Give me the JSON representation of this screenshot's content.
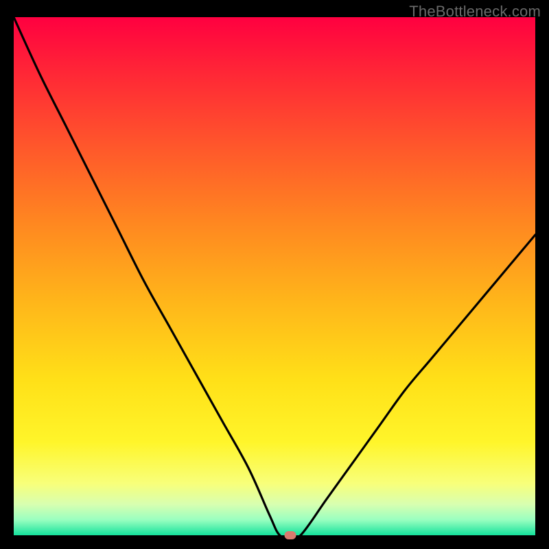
{
  "watermark": "TheBottleneck.com",
  "chart_data": {
    "type": "line",
    "title": "",
    "xlabel": "",
    "ylabel": "",
    "xlim": [
      0,
      100
    ],
    "ylim": [
      0,
      100
    ],
    "x": [
      0,
      5,
      10,
      15,
      20,
      25,
      30,
      35,
      40,
      45,
      49,
      51,
      53,
      55,
      60,
      65,
      70,
      75,
      80,
      85,
      90,
      95,
      100
    ],
    "y": [
      100,
      89,
      79,
      69,
      59,
      49,
      40,
      31,
      22,
      13,
      4,
      0,
      0,
      0,
      7,
      14,
      21,
      28,
      34,
      40,
      46,
      52,
      58
    ],
    "marker": {
      "x": 53,
      "y": 0
    },
    "gradient_stops": [
      {
        "offset": 0.0,
        "color": "#ff0040"
      },
      {
        "offset": 0.12,
        "color": "#ff2b35"
      },
      {
        "offset": 0.25,
        "color": "#ff572b"
      },
      {
        "offset": 0.4,
        "color": "#ff8820"
      },
      {
        "offset": 0.55,
        "color": "#ffb61a"
      },
      {
        "offset": 0.7,
        "color": "#ffe018"
      },
      {
        "offset": 0.82,
        "color": "#fff52a"
      },
      {
        "offset": 0.9,
        "color": "#f8ff7a"
      },
      {
        "offset": 0.94,
        "color": "#d8ffb0"
      },
      {
        "offset": 0.97,
        "color": "#9affc0"
      },
      {
        "offset": 1.0,
        "color": "#14e29c"
      }
    ]
  }
}
